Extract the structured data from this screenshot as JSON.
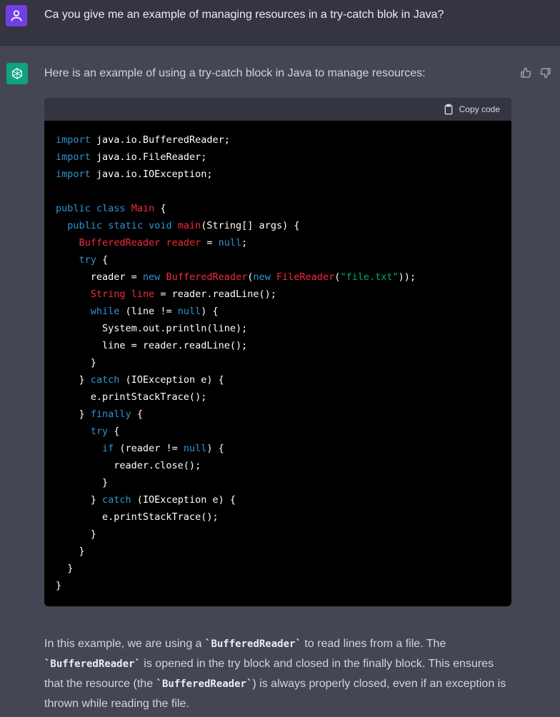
{
  "user": {
    "message": "Ca you give me an example of managing resources in a try-catch blok in Java?",
    "avatar_icon": "user-icon",
    "avatar_color": "#6f3fe3"
  },
  "assistant": {
    "avatar_icon": "openai-logo-icon",
    "avatar_color": "#10a37f",
    "intro": "Here is an example of using a try-catch block in Java to manage resources:",
    "feedback": {
      "thumbs_up_icon": "thumbs-up-icon",
      "thumbs_down_icon": "thumbs-down-icon"
    },
    "code_block": {
      "copy_label": "Copy code",
      "copy_icon": "clipboard-icon",
      "lines": [
        "import java.io.BufferedReader;",
        "import java.io.FileReader;",
        "import java.io.IOException;",
        "",
        "public class Main {",
        "  public static void main(String[] args) {",
        "    BufferedReader reader = null;",
        "    try {",
        "      reader = new BufferedReader(new FileReader(\"file.txt\"));",
        "      String line = reader.readLine();",
        "      while (line != null) {",
        "        System.out.println(line);",
        "        line = reader.readLine();",
        "      }",
        "    } catch (IOException e) {",
        "      e.printStackTrace();",
        "    } finally {",
        "      try {",
        "        if (reader != null) {",
        "          reader.close();",
        "        }",
        "      } catch (IOException e) {",
        "        e.printStackTrace();",
        "      }",
        "    }",
        "  }",
        "}"
      ]
    },
    "explanation": {
      "p1": "In this example, we are using a ",
      "c1": "`BufferedReader`",
      "p2": " to read lines from a file. The ",
      "c2": "`BufferedReader`",
      "p3": " is opened in the try block and closed in the finally block. This ensures that the resource (the ",
      "c3": "`BufferedReader`",
      "p4": ") is always properly closed, even if an exception is thrown while reading the file."
    }
  },
  "colors": {
    "background": "#444654",
    "user_row": "#343541",
    "keyword": "#2e95d3",
    "class_name": "#f22c3d",
    "string": "#00a67d"
  }
}
